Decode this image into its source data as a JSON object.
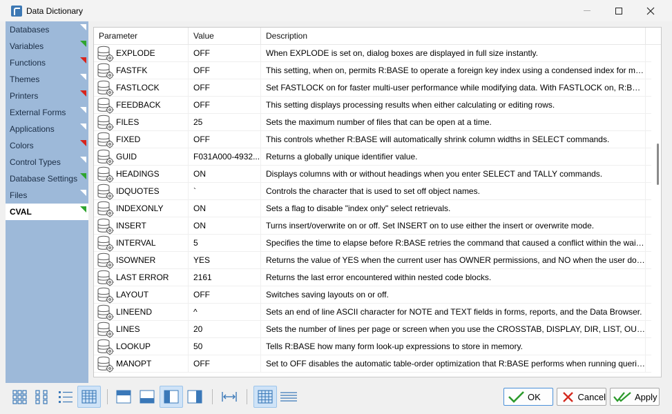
{
  "window": {
    "title": "Data Dictionary"
  },
  "sidebar": {
    "items": [
      {
        "label": "Databases",
        "marker": "white"
      },
      {
        "label": "Variables",
        "marker": "green"
      },
      {
        "label": "Functions",
        "marker": "red"
      },
      {
        "label": "Themes",
        "marker": "white"
      },
      {
        "label": "Printers",
        "marker": "red"
      },
      {
        "label": "External Forms",
        "marker": "white"
      },
      {
        "label": "Applications",
        "marker": "white"
      },
      {
        "label": "Colors",
        "marker": "red"
      },
      {
        "label": "Control Types",
        "marker": "white"
      },
      {
        "label": "Database Settings",
        "marker": "green"
      },
      {
        "label": "Files",
        "marker": "white"
      },
      {
        "label": "CVAL",
        "marker": "green",
        "active": true
      }
    ]
  },
  "grid": {
    "columns": [
      "Parameter",
      "Value",
      "Description"
    ],
    "rows": [
      {
        "param": "EXPLODE",
        "value": "OFF",
        "desc": "When EXPLODE is set on, dialog boxes are displayed in full size instantly."
      },
      {
        "param": "FASTFK",
        "value": "OFF",
        "desc": "This setting, when on, permits R:BASE to operate a foreign key index using a condensed index for mai..."
      },
      {
        "param": "FASTLOCK",
        "value": "OFF",
        "desc": "Set FASTLOCK on for faster multi-user performance while modifying data. With FASTLOCK on, R:BASE..."
      },
      {
        "param": "FEEDBACK",
        "value": "OFF",
        "desc": "This setting displays processing results when either calculating or editing rows."
      },
      {
        "param": "FILES",
        "value": "25",
        "desc": "Sets the maximum number of files that can be open at a time."
      },
      {
        "param": "FIXED",
        "value": "OFF",
        "desc": "This controls whether R:BASE will automatically shrink column widths in SELECT commands."
      },
      {
        "param": "GUID",
        "value": "F031A000-4932...",
        "desc": "Returns a globally unique identifier value."
      },
      {
        "param": "HEADINGS",
        "value": "ON",
        "desc": "Displays columns with or without headings when you enter SELECT and TALLY commands."
      },
      {
        "param": "IDQUOTES",
        "value": "`",
        "desc": "Controls the character that is used to set off object names."
      },
      {
        "param": "INDEXONLY",
        "value": "ON",
        "desc": "Sets a flag to disable \"index only\" select retrievals."
      },
      {
        "param": "INSERT",
        "value": "ON",
        "desc": "Turns insert/overwrite on or off. Set INSERT on to use either the insert or overwrite mode."
      },
      {
        "param": "INTERVAL",
        "value": "5",
        "desc": "Specifies the time to elapse before R:BASE retries the command that caused a conflict within the waiti..."
      },
      {
        "param": "ISOWNER",
        "value": "YES",
        "desc": "Returns the value of YES when the current user has OWNER permissions, and NO when the user does ..."
      },
      {
        "param": "LAST ERROR",
        "value": "2161",
        "desc": "Returns the last error encountered within nested code blocks."
      },
      {
        "param": "LAYOUT",
        "value": "OFF",
        "desc": "Switches saving layouts on or off."
      },
      {
        "param": "LINEEND",
        "value": "^",
        "desc": "Sets an end of line ASCII character for NOTE and TEXT fields in forms, reports, and the Data Browser."
      },
      {
        "param": "LINES",
        "value": "20",
        "desc": "Sets the number of lines per page or screen when you use the CROSSTAB, DISPLAY, DIR, LIST, OUTPUT,..."
      },
      {
        "param": "LOOKUP",
        "value": "50",
        "desc": "Tells R:BASE how many form look-up expressions to store in memory."
      },
      {
        "param": "MANOPT",
        "value": "OFF",
        "desc": "Set to OFF disables the automatic table-order optimization that R:BASE performs when running queries."
      }
    ]
  },
  "buttons": {
    "ok": "OK",
    "cancel": "Cancel",
    "apply": "Apply"
  }
}
